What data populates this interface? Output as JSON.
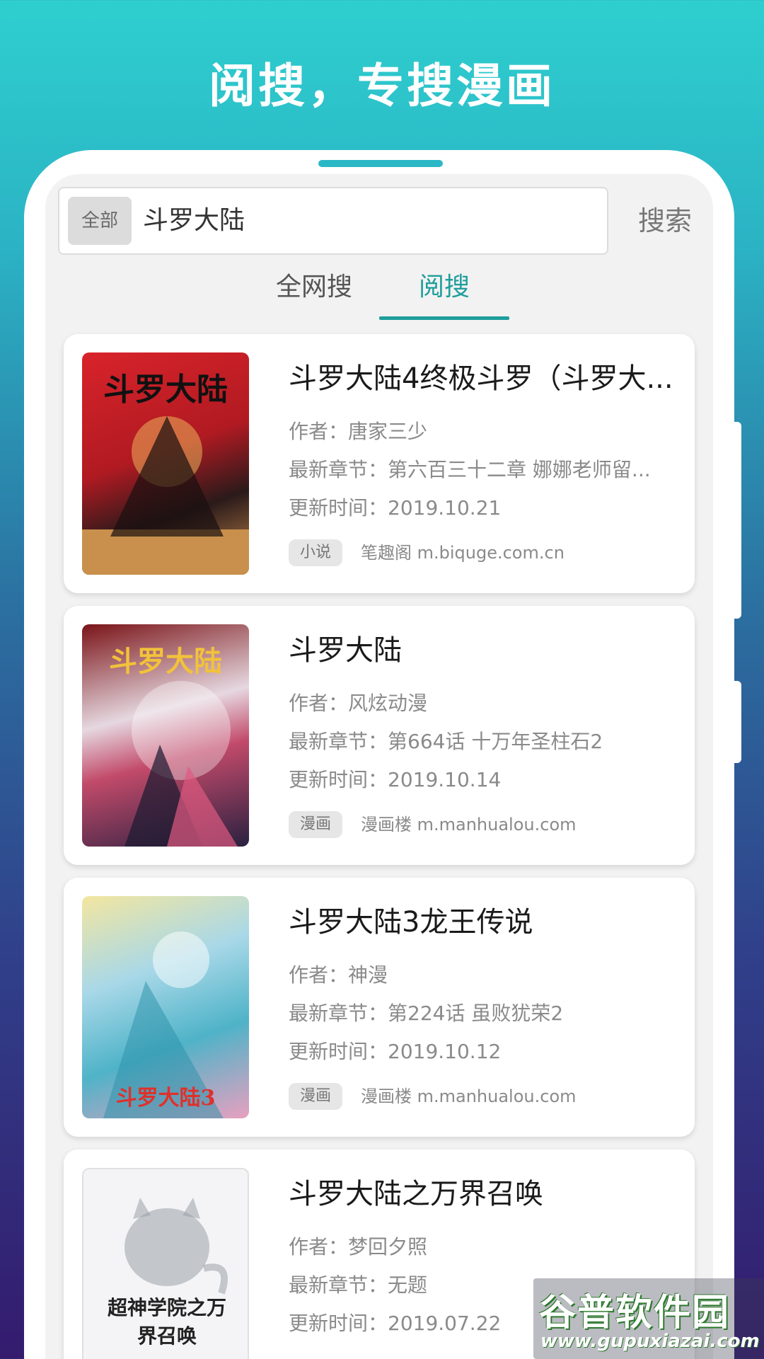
{
  "headline": "阅搜，专搜漫画",
  "search": {
    "scope_label": "全部",
    "query": "斗罗大陆",
    "button_label": "搜索"
  },
  "tabs": [
    {
      "label": "全网搜",
      "active": false
    },
    {
      "label": "阅搜",
      "active": true
    }
  ],
  "results": [
    {
      "title": "斗罗大陆4终极斗罗（斗罗大...",
      "author_label": "作者：",
      "author": "唐家三少",
      "chapter_label": "最新章节：",
      "chapter": "第六百三十二章 娜娜老师留...",
      "update_label": "更新时间：",
      "update": "2019.10.21",
      "tag": "小说",
      "source": "笔趣阁 m.biquge.com.cn",
      "cover_text": "斗罗大陆"
    },
    {
      "title": "斗罗大陆",
      "author_label": "作者：",
      "author": "风炫动漫",
      "chapter_label": "最新章节：",
      "chapter": "第664话 十万年圣柱石2",
      "update_label": "更新时间：",
      "update": "2019.10.14",
      "tag": "漫画",
      "source": "漫画楼 m.manhualou.com",
      "cover_text": "斗罗大陆"
    },
    {
      "title": "斗罗大陆3龙王传说",
      "author_label": "作者：",
      "author": "神漫",
      "chapter_label": "最新章节：",
      "chapter": "第224话 虽败犹荣2",
      "update_label": "更新时间：",
      "update": "2019.10.12",
      "tag": "漫画",
      "source": "漫画楼 m.manhualou.com",
      "cover_text": "斗罗大陆3"
    },
    {
      "title": "斗罗大陆之万界召唤",
      "author_label": "作者：",
      "author": "梦回夕照",
      "chapter_label": "最新章节：",
      "chapter": "无题",
      "update_label": "更新时间：",
      "update": "2019.07.22",
      "tag": "",
      "source": "",
      "cover_text": "超神学院之万界召唤"
    }
  ],
  "watermark": {
    "name": "谷普软件园",
    "url": "www.gupuxiazai.com"
  },
  "colors": {
    "accent": "#1f9e9c",
    "gradient_top": "#2ecfcf",
    "gradient_bottom": "#341b6e"
  }
}
